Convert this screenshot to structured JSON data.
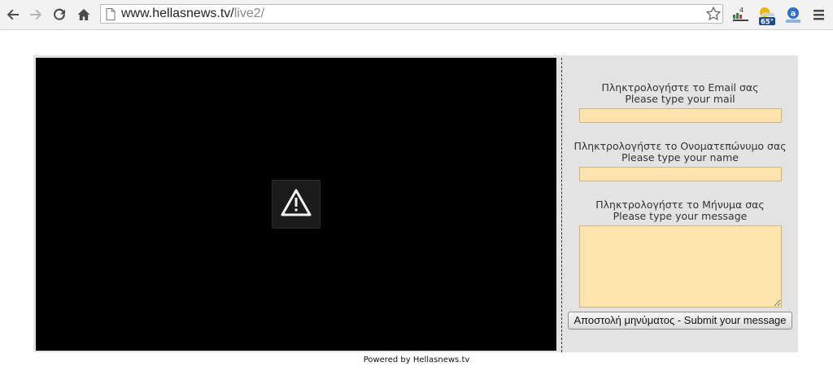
{
  "browser": {
    "url_host": "www.hellasnews.tv/",
    "url_path": "live2/",
    "weather_temp": "65°"
  },
  "form": {
    "email_label_gr": "Πληκτρολογήστε το Email σας",
    "email_label_en": "Please type your mail",
    "email_value": "",
    "name_label_gr": "Πληκτρολογήστε το Ονοματεπώνυμο σας",
    "name_label_en": "Please type your name",
    "name_value": "",
    "message_label_gr": "Πληκτρολογήστε το Μήνυμα σας",
    "message_label_en": "Please type your message",
    "message_value": "",
    "submit_label": "Αποστολή μηνύματος - Submit your message"
  },
  "footer": {
    "text": "Powered by Hellasnews.tv"
  },
  "colors": {
    "field_bg": "#fde3ad",
    "panel_bg": "#e3e3e3",
    "player_bg": "#000000"
  },
  "icons": [
    "back-icon",
    "forward-icon",
    "reload-icon",
    "home-icon",
    "page-icon",
    "star-icon",
    "signal-extension-icon",
    "weather-extension-icon",
    "translate-extension-icon",
    "menu-icon",
    "warning-icon"
  ]
}
